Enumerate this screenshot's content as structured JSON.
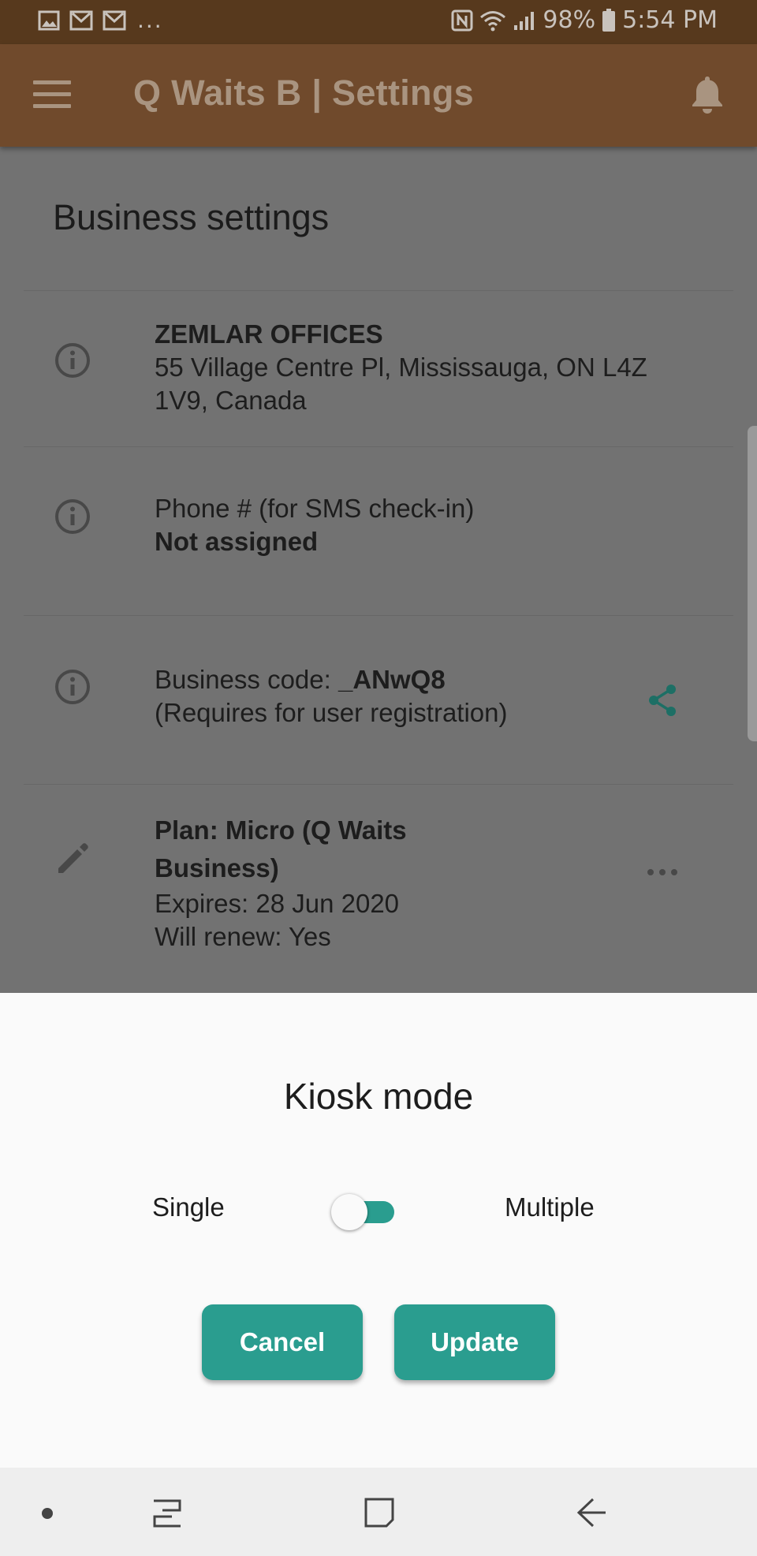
{
  "status_bar": {
    "left_icons": [
      "gallery-icon",
      "gmail-icon",
      "gmail-icon"
    ],
    "overflow": "...",
    "right_icons": [
      "nfc-icon",
      "wifi-icon",
      "signal-icon",
      "battery-icon"
    ],
    "battery": "98%",
    "time": "5:54 PM"
  },
  "app_bar": {
    "title": "Q Waits B | Settings",
    "menu_icon": "menu-icon",
    "notifications_icon": "bell-icon"
  },
  "settings": {
    "heading": "Business settings",
    "business": {
      "name": "ZEMLAR OFFICES",
      "address": "55 Village Centre Pl, Mississauga, ON L4Z 1V9, Canada"
    },
    "phone": {
      "label": "Phone # (for SMS check-in)",
      "value": "Not assigned"
    },
    "business_code": {
      "label": "Business code: ",
      "code": "_ANwQ8",
      "note": "(Requires for user registration)"
    },
    "plan": {
      "title": "Plan: Micro (Q Waits Business)",
      "expires": "Expires: 28 Jun 2020",
      "renew": "Will renew: Yes"
    }
  },
  "dialog": {
    "title": "Kiosk mode",
    "left_label": "Single",
    "right_label": "Multiple",
    "cancel_label": "Cancel",
    "update_label": "Update"
  },
  "colors": {
    "accent": "#2a9d8f",
    "app_bar": "#704a2c",
    "status_bar": "#57391d"
  }
}
